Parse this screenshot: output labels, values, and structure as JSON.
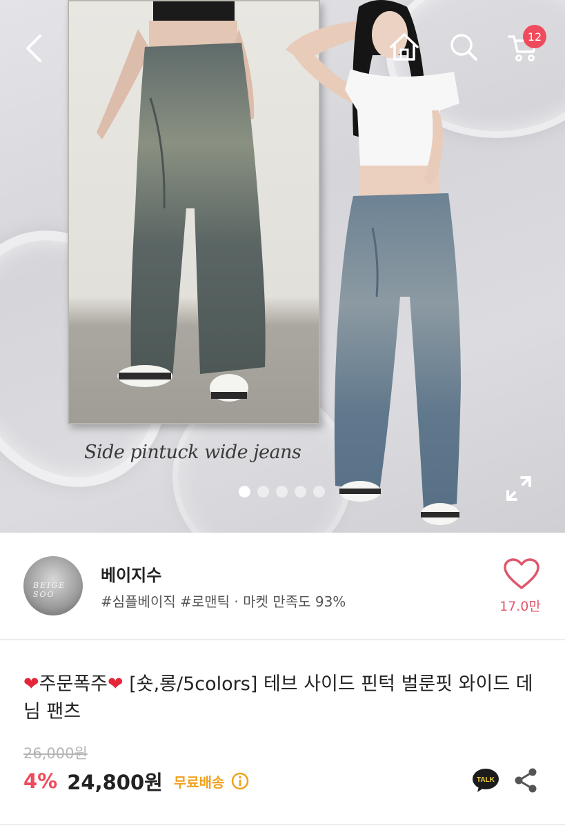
{
  "hero": {
    "caption": "Side pintuck wide jeans",
    "slide_count": 5,
    "active_slide": 1
  },
  "header": {
    "cart_count": "12"
  },
  "shop": {
    "name": "베이지수",
    "tags": "#심플베이직 #로맨틱 · 마켓 만족도 93%",
    "favorites": "17.0만"
  },
  "product": {
    "title_badge": "주문폭주",
    "title_text": " [숏,롱/5colors] 테브 사이드 핀턱 벌룬핏 와이드 데님 팬츠",
    "original_price": "26,000원",
    "discount": "4%",
    "price": "24,800원",
    "shipping": "무료배송"
  },
  "icons": {
    "back": "chevron-left-icon",
    "home": "home-icon",
    "search": "search-icon",
    "cart": "cart-icon",
    "expand": "expand-icon",
    "favorite": "heart-icon",
    "talk": "kakaotalk-icon",
    "share": "share-icon",
    "info": "info-icon"
  },
  "colors": {
    "accent_red": "#ef4b5c",
    "shipping_orange": "#f0a21e",
    "favorite_pink": "#e0566a"
  }
}
